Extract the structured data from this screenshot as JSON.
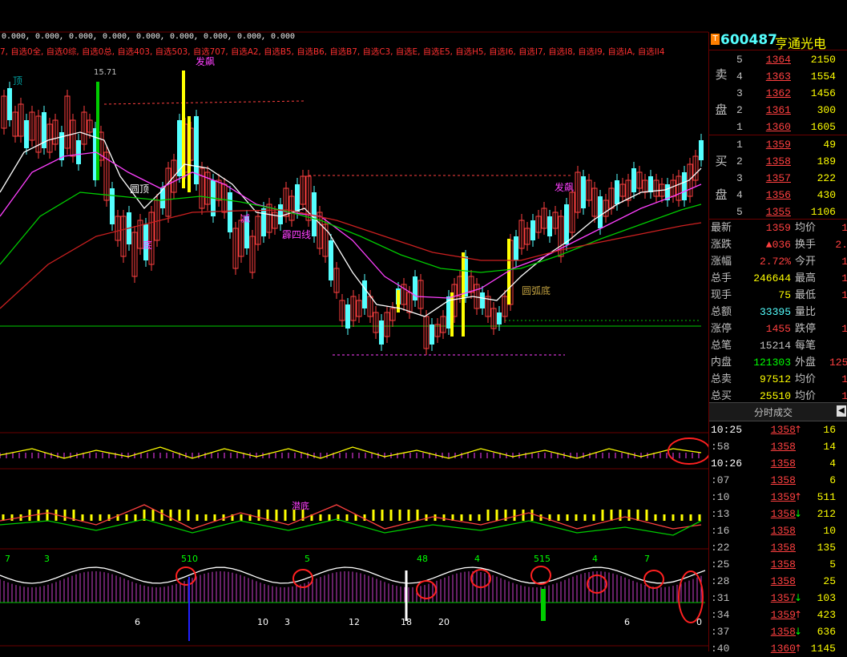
{
  "colors": {
    "up": "#ff4040",
    "down": "#54ffff",
    "yellow": "#ffff00",
    "magenta": "#ff40ff",
    "green": "#00cc00",
    "white": "#ffffff"
  },
  "topbar": {
    "values_line": "0.000, 0.000, 0.000, 0.000, 0.000, 0.000, 0.000, 0.000, 0.000",
    "lists_line": "7, 自选0全, 自选0综, 自选0总, 自选403, 自选503, 自选707, 自选A2, 自选B5, 自选B6, 自选B7, 自选C3, 自选E, 自选E5, 自选H5, 自选I6, 自选I7, 自选I8, 自选I9, 自选IA, 自选II4"
  },
  "chart": {
    "max_label": "15.71",
    "annotations": {
      "fa_biao_1": "发飙",
      "fa_biao_2": "发飙",
      "yuan_ding": "圆顶",
      "ding": "顶",
      "di": "底",
      "yuan_hu_di": "圆弧底",
      "ji_si_xian": "霹四线",
      "jian": "减",
      "ji_jie": "潜底"
    },
    "panel3_numbers": [
      "7",
      "3",
      "510",
      "5",
      "48",
      "4",
      "515",
      "4",
      "7"
    ],
    "panel3_bottom": [
      "6",
      "10",
      "3",
      "12",
      "18",
      "20",
      "6",
      "0"
    ]
  },
  "stock": {
    "code": "600487",
    "name": "亨通光电",
    "badge": "T"
  },
  "orderbook": {
    "sell_label_1": "卖",
    "sell_label_2": "盘",
    "buy_label_1": "买",
    "buy_label_2": "盘",
    "sell": [
      {
        "lvl": "5",
        "price": "1364",
        "vol": "2150"
      },
      {
        "lvl": "4",
        "price": "1363",
        "vol": "1554"
      },
      {
        "lvl": "3",
        "price": "1362",
        "vol": "1456"
      },
      {
        "lvl": "2",
        "price": "1361",
        "vol": "300"
      },
      {
        "lvl": "1",
        "price": "1360",
        "vol": "1605"
      }
    ],
    "buy": [
      {
        "lvl": "1",
        "price": "1359",
        "vol": "49"
      },
      {
        "lvl": "2",
        "price": "1358",
        "vol": "189"
      },
      {
        "lvl": "3",
        "price": "1357",
        "vol": "222"
      },
      {
        "lvl": "4",
        "price": "1356",
        "vol": "430"
      },
      {
        "lvl": "5",
        "price": "1355",
        "vol": "1106"
      }
    ]
  },
  "stats": [
    {
      "label": "最新",
      "value": "1359",
      "vc": "#ff4040",
      "label2": "均价",
      "value2": "1"
    },
    {
      "label": "涨跌",
      "value": "▲036",
      "vc": "#ff4040",
      "label2": "换手",
      "value2": "2."
    },
    {
      "label": "涨幅",
      "value": "2.72%",
      "vc": "#ff4040",
      "label2": "今开",
      "value2": "1"
    },
    {
      "label": "总手",
      "value": "246644",
      "vc": "#ffff00",
      "label2": "最高",
      "value2": "1"
    },
    {
      "label": "现手",
      "value": "75",
      "vc": "#ffff00",
      "label2": "最低",
      "value2": "1"
    },
    {
      "label": "总额",
      "value": "33395",
      "vc": "#54ffff",
      "label2": "量比",
      "value2": ""
    },
    {
      "label": "涨停",
      "value": "1455",
      "vc": "#ff4040",
      "label2": "跌停",
      "value2": "1"
    },
    {
      "label": "总笔",
      "value": "15214",
      "vc": "#c0c0c0",
      "label2": "每笔",
      "value2": ""
    },
    {
      "label": "内盘",
      "value": "121303",
      "vc": "#00ff00",
      "label2": "外盘",
      "value2": "125"
    },
    {
      "label": "总卖",
      "value": "97512",
      "vc": "#ffff00",
      "label2": "均价",
      "value2": "1"
    },
    {
      "label": "总买",
      "value": "25510",
      "vc": "#ffff00",
      "label2": "均价",
      "value2": "1"
    }
  ],
  "ticks_header": "分时成交",
  "ticks": [
    {
      "t": "10:25",
      "p": "1358",
      "a": "↑",
      "v": "16"
    },
    {
      "t": ":58",
      "p": "1358",
      "a": "",
      "v": "14"
    },
    {
      "t": "10:26",
      "p": "1358",
      "a": "",
      "v": "4"
    },
    {
      "t": ":07",
      "p": "1358",
      "a": "",
      "v": "6"
    },
    {
      "t": ":10",
      "p": "1359",
      "a": "↑",
      "v": "511"
    },
    {
      "t": ":13",
      "p": "1358",
      "a": "↓",
      "v": "212"
    },
    {
      "t": ":16",
      "p": "1358",
      "a": "",
      "v": "10"
    },
    {
      "t": ":22",
      "p": "1358",
      "a": "",
      "v": "135"
    },
    {
      "t": ":25",
      "p": "1358",
      "a": "",
      "v": "5"
    },
    {
      "t": ":28",
      "p": "1358",
      "a": "",
      "v": "25"
    },
    {
      "t": ":31",
      "p": "1357",
      "a": "↓",
      "v": "103"
    },
    {
      "t": ":34",
      "p": "1359",
      "a": "↑",
      "v": "423"
    },
    {
      "t": ":37",
      "p": "1358",
      "a": "↓",
      "v": "636"
    },
    {
      "t": ":40",
      "p": "1360",
      "a": "↑",
      "v": "1145"
    }
  ]
}
